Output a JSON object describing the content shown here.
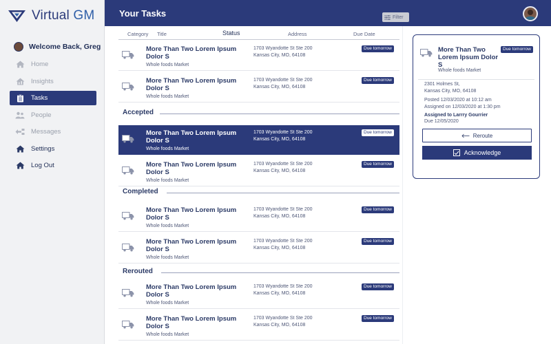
{
  "app": {
    "logo_text_virtual": "Virtual",
    "logo_text_gm": "GM",
    "welcome": "Welcome Back, Greg"
  },
  "nav": [
    {
      "label": "Home",
      "icon": "home-icon",
      "state": "disabled"
    },
    {
      "label": "Insights",
      "icon": "insights-icon",
      "state": "disabled"
    },
    {
      "label": "Tasks",
      "icon": "tasks-icon",
      "state": "active"
    },
    {
      "label": "People",
      "icon": "people-icon",
      "state": "disabled"
    },
    {
      "label": "Messages",
      "icon": "messages-icon",
      "state": "disabled"
    },
    {
      "label": "Settings",
      "icon": "settings-icon",
      "state": "normal"
    },
    {
      "label": "Log Out",
      "icon": "logout-icon",
      "state": "normal"
    }
  ],
  "header": {
    "title": "Your Tasks",
    "filter_label": "Filter"
  },
  "columns": {
    "category": "Category",
    "title": "Title",
    "status": "Status",
    "address": "Address",
    "due_date": "Due Date"
  },
  "sections": {
    "accepted": "Accepted",
    "completed": "Completed",
    "rerouted": "Rerouted"
  },
  "tasks": [
    {
      "title": "More Than Two Lorem Ipsum Dolor S",
      "subtitle": "Whole foods Market",
      "address_line1": "1703 Wyandotte St Ste 200",
      "address_line2": "Kansas City, MO, 64108",
      "badge": "Due tomorrow"
    },
    {
      "title": "More Than Two Lorem Ipsum Dolor S",
      "subtitle": "Whole foods Market",
      "address_line1": "1703 Wyandotte St Ste 200",
      "address_line2": "Kansas City, MO, 64108",
      "badge": "Due tomorrow"
    },
    {
      "title": "More Than Two Lorem Ipsum Dolor S",
      "subtitle": "Whole foods Market",
      "address_line1": "1703 Wyandotte St Ste 200",
      "address_line2": "Kansas City, MO, 64108",
      "badge": "Due tomorrow"
    },
    {
      "title": "More Than Two Lorem Ipsum Dolor S",
      "subtitle": "Whole foods Market",
      "address_line1": "1703 Wyandotte St Ste 200",
      "address_line2": "Kansas City, MO, 64108",
      "badge": "Due tomorrow"
    },
    {
      "title": "More Than Two Lorem Ipsum Dolor S",
      "subtitle": "Whole foods Market",
      "address_line1": "1703 Wyandotte St Ste 200",
      "address_line2": "Kansas City, MO, 64108",
      "badge": "Due tomorrow"
    },
    {
      "title": "More Than Two Lorem Ipsum Dolor S",
      "subtitle": "Whole foods Market",
      "address_line1": "1703 Wyandotte St Ste 200",
      "address_line2": "Kansas City, MO, 64108",
      "badge": "Due tomorrow"
    },
    {
      "title": "More Than Two Lorem Ipsum Dolor S",
      "subtitle": "Whole foods Market",
      "address_line1": "1703 Wyandotte St Ste 200",
      "address_line2": "Kansas City, MO, 64108",
      "badge": "Due tomorrow"
    },
    {
      "title": "More Than Two Lorem Ipsum Dolor S",
      "subtitle": "Whole foods Market",
      "address_line1": "1703 Wyandotte St Ste 200",
      "address_line2": "Kansas City, MO, 64108",
      "badge": "Due tomorrow"
    }
  ],
  "detail": {
    "title": "More Than Two Lorem Ipsum Dolor S",
    "subtitle": "Whole foods Market",
    "badge": "Due tomorrow",
    "address_line1": "2301 Holmes St,",
    "address_line2": "Kansas City, MO, 64108",
    "posted": "Posted 12/03/2020 at 10:12 am",
    "assigned_on": "Assigned on 12/03/2020 at 1:30 pm",
    "assigned_to": "Assigned to Larrry Gourrier",
    "due": "Due 12/05/2020",
    "reroute_label": "Reroute",
    "acknowledge_label": "Acknowledge"
  },
  "colors": {
    "primary": "#2b3a7a",
    "sidebar_bg": "#f1f2f4",
    "text_dark": "#2b3a66",
    "text_muted": "#9aa0ac"
  }
}
